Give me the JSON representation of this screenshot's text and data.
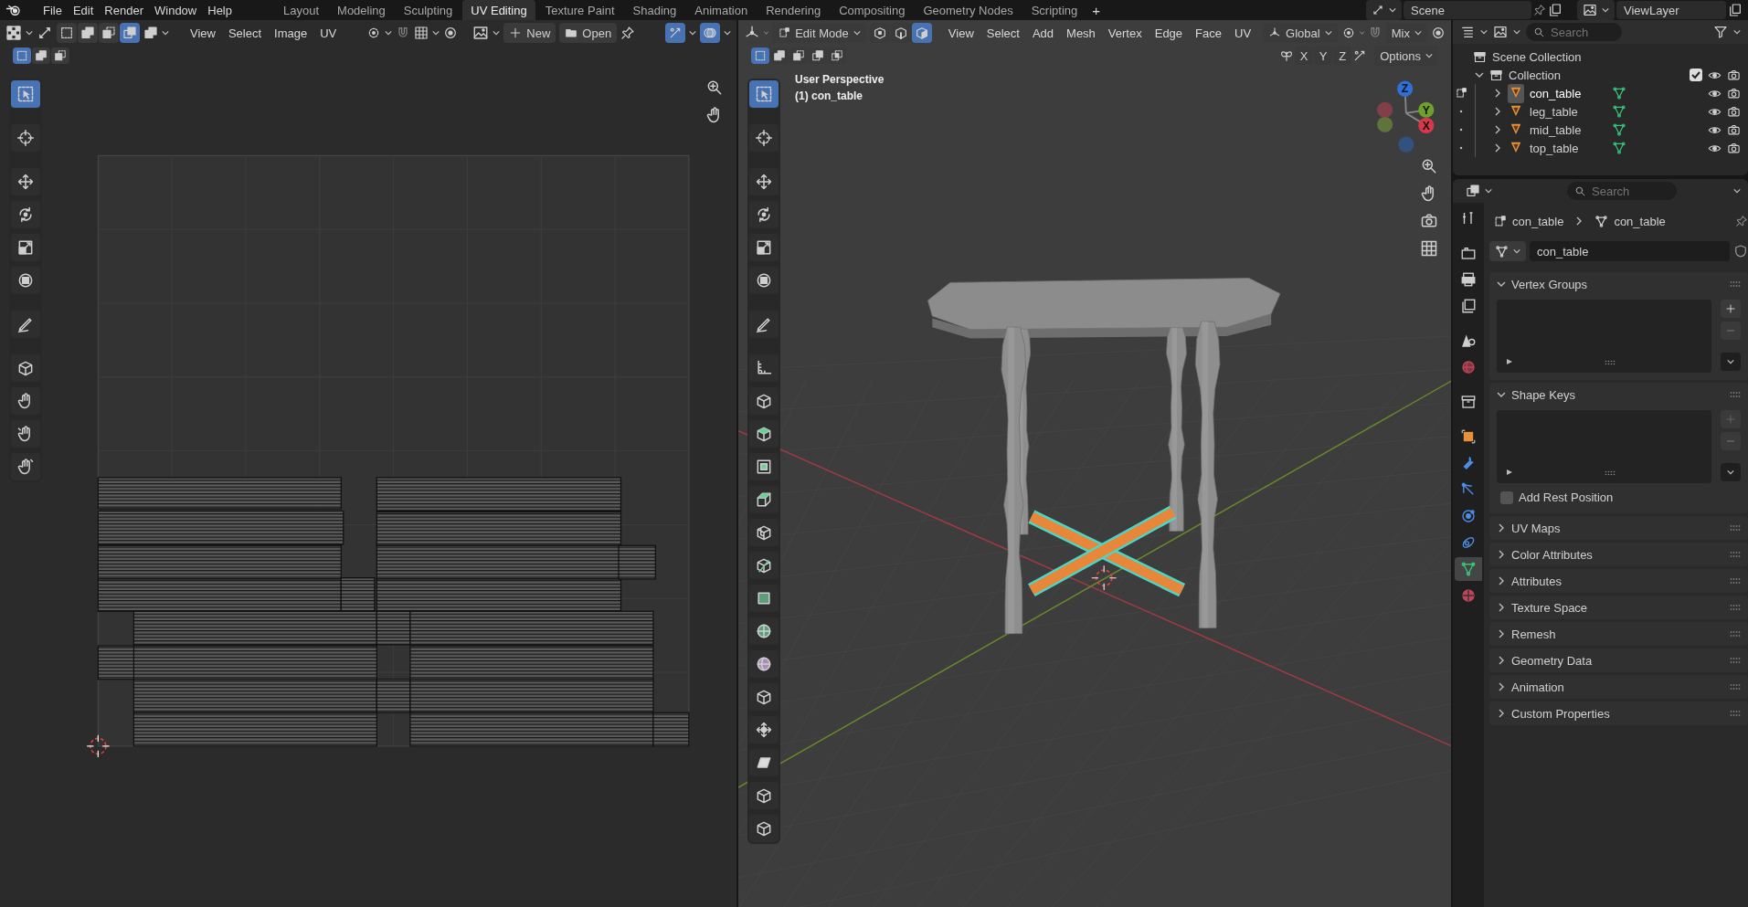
{
  "topbar": {
    "menus": [
      "File",
      "Edit",
      "Render",
      "Window",
      "Help"
    ],
    "workspaces": [
      {
        "label": "Layout",
        "selected": false
      },
      {
        "label": "Modeling",
        "selected": false
      },
      {
        "label": "Sculpting",
        "selected": false
      },
      {
        "label": "UV Editing",
        "selected": true
      },
      {
        "label": "Texture Paint",
        "selected": false
      },
      {
        "label": "Shading",
        "selected": false
      },
      {
        "label": "Animation",
        "selected": false
      },
      {
        "label": "Rendering",
        "selected": false
      },
      {
        "label": "Compositing",
        "selected": false
      },
      {
        "label": "Geometry Nodes",
        "selected": false
      },
      {
        "label": "Scripting",
        "selected": false
      }
    ],
    "add_workspace": "+",
    "scene": "Scene",
    "view_layer": "ViewLayer"
  },
  "uv_editor": {
    "select_modes": [
      {
        "selected": false
      },
      {
        "selected": false
      },
      {
        "selected": false
      },
      {
        "selected": true
      }
    ],
    "menus": [
      "View",
      "Select",
      "Image",
      "UV"
    ],
    "new_button": "New",
    "open_button": "Open",
    "box_modes": [
      {
        "selected": true
      },
      {
        "selected": false
      },
      {
        "selected": false
      }
    ],
    "tools": [
      {
        "kind": "select",
        "selected": true
      },
      {
        "kind": "cursor",
        "selected": false
      },
      {
        "kind": "move",
        "selected": false
      },
      {
        "kind": "rotate",
        "selected": false
      },
      {
        "kind": "scale",
        "selected": false
      },
      {
        "kind": "transform",
        "selected": false
      },
      {
        "kind": "annotate",
        "selected": false
      },
      {
        "kind": "rip",
        "selected": false
      },
      {
        "kind": "grab",
        "selected": false
      },
      {
        "kind": "relax",
        "selected": false
      },
      {
        "kind": "pinch",
        "selected": false
      }
    ]
  },
  "viewport": {
    "mode": "Edit Mode",
    "select_modes": [
      {
        "selected": false
      },
      {
        "selected": false
      },
      {
        "selected": true
      }
    ],
    "menus": [
      "View",
      "Select",
      "Add",
      "Mesh",
      "Vertex",
      "Edge",
      "Face",
      "UV"
    ],
    "orientation": "Global",
    "snap": "Mix",
    "axes": [
      "X",
      "Y",
      "Z"
    ],
    "options": "Options",
    "box_modes": [
      {
        "selected": true
      },
      {
        "selected": false
      },
      {
        "selected": false
      },
      {
        "selected": false
      },
      {
        "selected": false
      }
    ],
    "overlay": [
      "User Perspective",
      "(1) con_table"
    ],
    "gizmo": [
      "Z",
      "Y",
      "X"
    ],
    "tools": [
      {
        "kind": "select",
        "selected": true
      },
      {
        "kind": "cursor",
        "selected": false
      },
      {
        "kind": "move",
        "selected": false
      },
      {
        "kind": "rotate",
        "selected": false
      },
      {
        "kind": "scale",
        "selected": false
      },
      {
        "kind": "transform",
        "selected": false
      },
      {
        "kind": "annotate",
        "selected": false
      },
      {
        "kind": "measure",
        "selected": false
      },
      {
        "kind": "add_cube",
        "selected": false
      },
      {
        "kind": "extrude",
        "selected": false
      },
      {
        "kind": "inset",
        "selected": false
      },
      {
        "kind": "bevel",
        "selected": false
      },
      {
        "kind": "loop_cut",
        "selected": false
      },
      {
        "kind": "knife",
        "selected": false
      },
      {
        "kind": "poly_build",
        "selected": false
      },
      {
        "kind": "spin",
        "selected": false
      },
      {
        "kind": "smooth",
        "selected": false
      },
      {
        "kind": "edge_slide",
        "selected": false
      },
      {
        "kind": "shrink",
        "selected": false
      },
      {
        "kind": "shear",
        "selected": false
      },
      {
        "kind": "rip_region",
        "selected": false
      },
      {
        "kind": "rip_edge",
        "selected": false
      }
    ]
  },
  "outliner": {
    "search_placeholder": "Search",
    "root": "Scene Collection",
    "collection": {
      "name": "Collection",
      "expanded": true,
      "checked": true,
      "children": [
        {
          "name": "con_table",
          "selected": true,
          "expanded": false
        },
        {
          "name": "leg_table",
          "selected": false,
          "expanded": false
        },
        {
          "name": "mid_table",
          "selected": false,
          "expanded": false
        },
        {
          "name": "top_table",
          "selected": false,
          "expanded": false
        }
      ]
    }
  },
  "properties": {
    "search_placeholder": "Search",
    "tabs": [
      {
        "kind": "tool",
        "selected": false
      },
      {
        "kind": "render",
        "selected": false
      },
      {
        "kind": "output",
        "selected": false
      },
      {
        "kind": "view_layer",
        "selected": false
      },
      {
        "kind": "scene",
        "selected": false
      },
      {
        "kind": "world",
        "selected": false
      },
      {
        "kind": "collection",
        "selected": false
      },
      {
        "kind": "object",
        "selected": false
      },
      {
        "kind": "modifiers",
        "selected": false
      },
      {
        "kind": "particles",
        "selected": false
      },
      {
        "kind": "physics",
        "selected": false
      },
      {
        "kind": "constraints",
        "selected": false
      },
      {
        "kind": "data",
        "selected": true
      },
      {
        "kind": "material",
        "selected": false
      }
    ],
    "breadcrumb": [
      "con_table",
      "con_table"
    ],
    "mesh_name": "con_table",
    "panels": [
      {
        "title": "Vertex Groups",
        "expanded": true,
        "kind": "list"
      },
      {
        "title": "Shape Keys",
        "expanded": true,
        "kind": "list",
        "option": {
          "label": "Add Rest Position",
          "checked": false
        }
      },
      {
        "title": "UV Maps",
        "expanded": false
      },
      {
        "title": "Color Attributes",
        "expanded": false
      },
      {
        "title": "Attributes",
        "expanded": false
      },
      {
        "title": "Texture Space",
        "expanded": false
      },
      {
        "title": "Remesh",
        "expanded": false
      },
      {
        "title": "Geometry Data",
        "expanded": false
      },
      {
        "title": "Animation",
        "expanded": false
      },
      {
        "title": "Custom Properties",
        "expanded": false
      }
    ]
  }
}
